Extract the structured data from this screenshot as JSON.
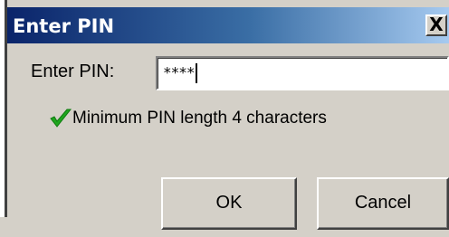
{
  "window": {
    "title": "Enter PIN",
    "close_glyph": "X"
  },
  "form": {
    "pin_label": "Enter PIN:",
    "pin_value": "****",
    "hint_icon": "check-icon",
    "hint_text": "Minimum PIN length 4 characters",
    "hint_icon_color": "#1fa51f"
  },
  "buttons": {
    "ok_label": "OK",
    "cancel_label": "Cancel"
  },
  "colors": {
    "title_bar_start": "#0a246a",
    "title_bar_end": "#a6caf0",
    "dialog_bg": "#d4d0c8"
  }
}
